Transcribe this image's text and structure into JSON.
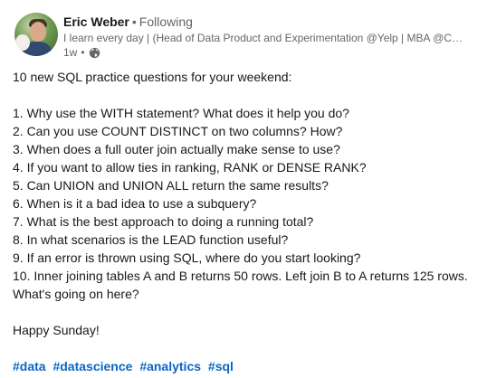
{
  "post": {
    "author": {
      "name": "Eric Weber",
      "separator": "•",
      "follow_status": "Following",
      "headline": "I learn every day | (Head of Data Product and Experimentation @Yelp | MBA @Chi...",
      "time": "1w",
      "time_dot": "•",
      "visibility_icon": "globe-icon"
    },
    "intro": "10 new SQL practice questions for your weekend:",
    "questions": [
      "1. Why use the WITH statement? What does it help you do?",
      "2. Can you use COUNT DISTINCT on two columns? How?",
      "3. When does a full outer join actually make sense to use?",
      "4. If you want to allow ties in ranking, RANK or DENSE RANK?",
      "5. Can UNION and UNION ALL return the same results?",
      "6. When is it a bad idea to use a subquery?",
      "7. What is the best approach to doing a running total?",
      "8. In what scenarios is the LEAD function useful?",
      "9. If an error is thrown using SQL, where do you start looking?",
      "10. Inner joining tables A and B returns 50 rows. Left join B to A returns 125 rows. What's going on here?"
    ],
    "signoff": "Happy Sunday!",
    "hashtags": [
      "#data",
      "#datascience",
      "#analytics",
      "#sql"
    ],
    "colors": {
      "text": "#191919",
      "muted": "#666666",
      "link": "#0a66c2"
    }
  }
}
